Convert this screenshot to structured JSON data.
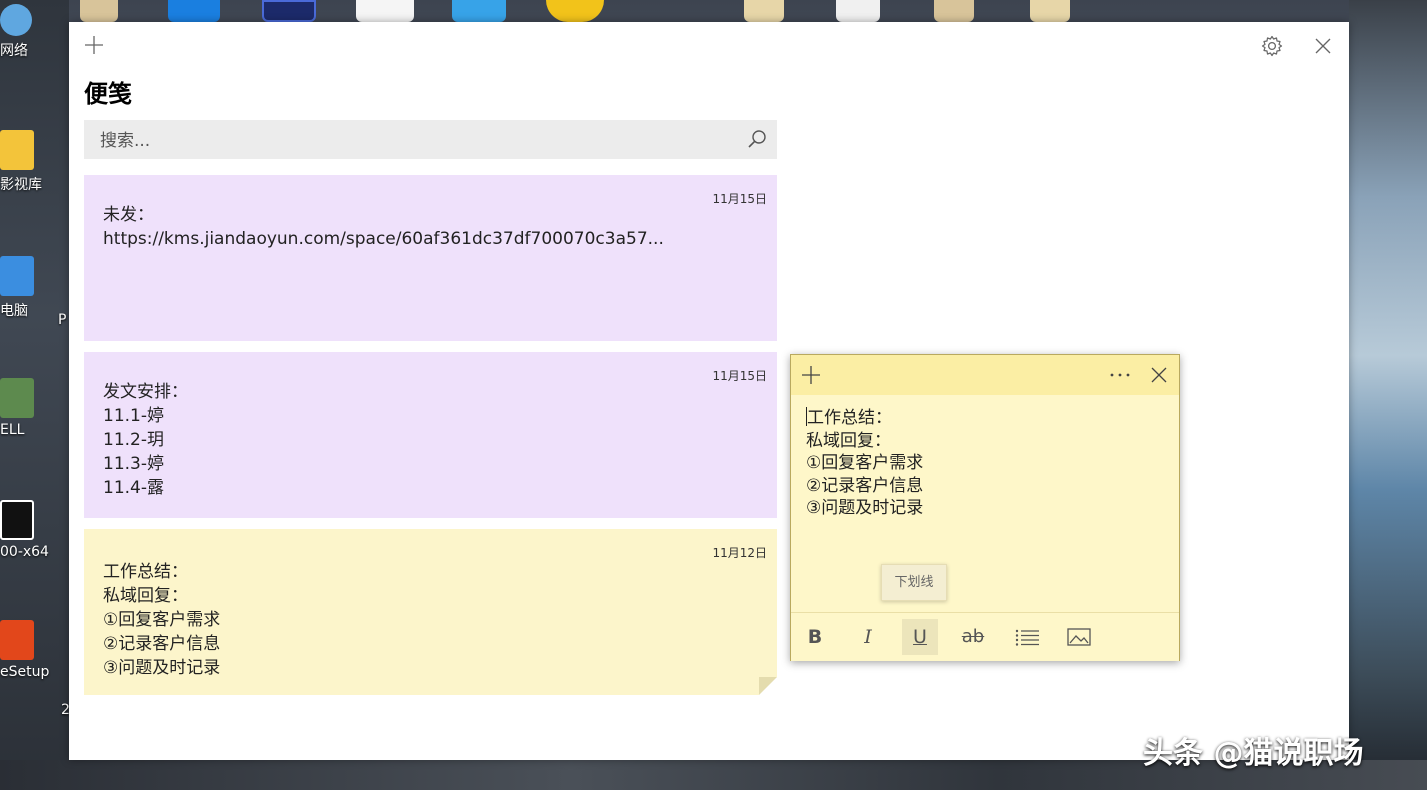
{
  "desktop": {
    "icons": [
      {
        "label": "网络"
      },
      {
        "label": "影视库"
      },
      {
        "label": "电脑"
      },
      {
        "label": "ELL"
      },
      {
        "label": "00-x64"
      },
      {
        "label": "eSetup"
      }
    ],
    "side_fragments": {
      "p": "P",
      "two": "2"
    }
  },
  "window": {
    "title": "便笺",
    "search_placeholder": "搜索..."
  },
  "notes": [
    {
      "date": "11月15日",
      "lines": [
        "未发：",
        "",
        "",
        "",
        "https://kms.jiandaoyun.com/space/60af361dc37df700070c3a57..."
      ],
      "color": "purple"
    },
    {
      "date": "11月15日",
      "lines": [
        "发文安排：",
        "11.1-婷",
        "11.2-玥",
        "11.3-婷",
        "11.4-露"
      ],
      "color": "purple"
    },
    {
      "date": "11月12日",
      "lines": [
        "工作总结：",
        "私域回复：",
        "①回复客户需求",
        "②记录客户信息",
        "③问题及时记录"
      ],
      "color": "yellow"
    }
  ],
  "sticky": {
    "lines": [
      "工作总结：",
      "私域回复：",
      "①回复客户需求",
      "②记录客户信息",
      "③问题及时记录"
    ],
    "tooltip": "下划线",
    "toolbar": {
      "bold": "B",
      "italic": "I",
      "underline": "U",
      "strike": "ab"
    }
  },
  "colors": {
    "purple_note": "#efe1fb",
    "yellow_note": "#fcf5cb",
    "sticky_header": "#fbeea4"
  },
  "watermark": "头条 @猫说职场"
}
